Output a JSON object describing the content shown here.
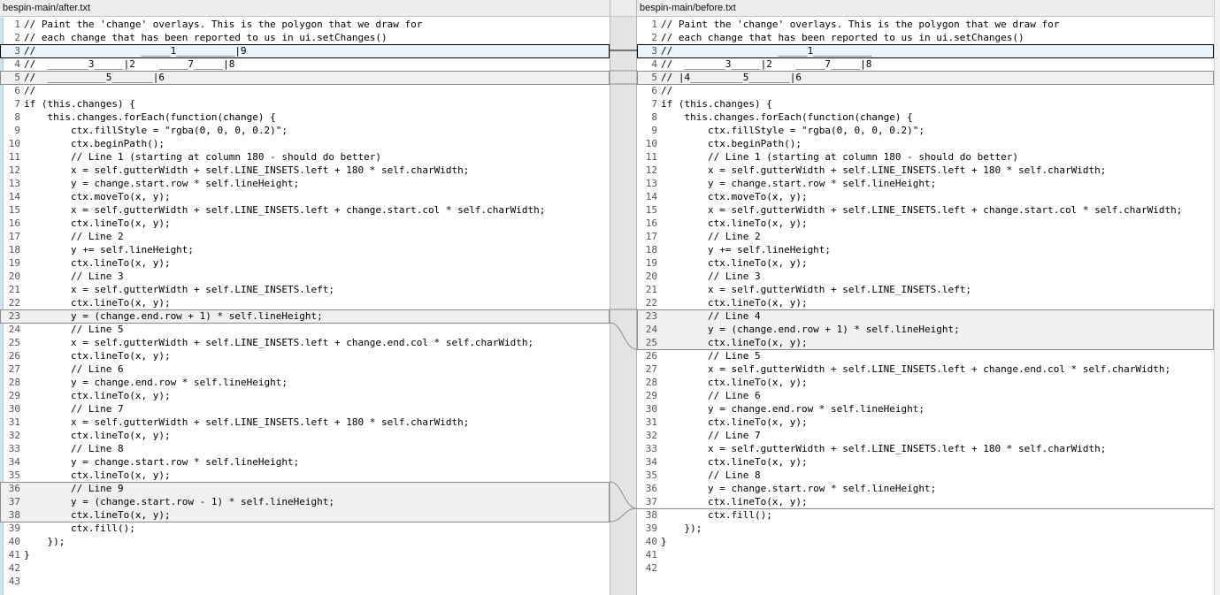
{
  "left_pane": {
    "title": "bespin-main/after.txt",
    "lines": [
      "// Paint the 'change' overlays. This is the polygon that we draw for",
      "// each change that has been reported to us in ui.setChanges()",
      "//                  _____1__________|9",
      "//  _______3_____|2    _____7_____|8",
      "//  __________5_______|6",
      "//",
      "if (this.changes) {",
      "    this.changes.forEach(function(change) {",
      "        ctx.fillStyle = \"rgba(0, 0, 0, 0.2)\";",
      "        ctx.beginPath();",
      "        // Line 1 (starting at column 180 - should do better)",
      "        x = self.gutterWidth + self.LINE_INSETS.left + 180 * self.charWidth;",
      "        y = change.start.row * self.lineHeight;",
      "        ctx.moveTo(x, y);",
      "        x = self.gutterWidth + self.LINE_INSETS.left + change.start.col * self.charWidth;",
      "        ctx.lineTo(x, y);",
      "        // Line 2",
      "        y += self.lineHeight;",
      "        ctx.lineTo(x, y);",
      "        // Line 3",
      "        x = self.gutterWidth + self.LINE_INSETS.left;",
      "        ctx.lineTo(x, y);",
      "        y = (change.end.row + 1) * self.lineHeight;",
      "        // Line 5",
      "        x = self.gutterWidth + self.LINE_INSETS.left + change.end.col * self.charWidth;",
      "        ctx.lineTo(x, y);",
      "        // Line 6",
      "        y = change.end.row * self.lineHeight;",
      "        ctx.lineTo(x, y);",
      "        // Line 7",
      "        x = self.gutterWidth + self.LINE_INSETS.left + 180 * self.charWidth;",
      "        ctx.lineTo(x, y);",
      "        // Line 8",
      "        y = change.start.row * self.lineHeight;",
      "        ctx.lineTo(x, y);",
      "        // Line 9",
      "        y = (change.start.row - 1) * self.lineHeight;",
      "        ctx.lineTo(x, y);",
      "        ctx.fill();",
      "    });",
      "}",
      "",
      ""
    ]
  },
  "right_pane": {
    "title": "bespin-main/before.txt",
    "lines": [
      "// Paint the 'change' overlays. This is the polygon that we draw for",
      "// each change that has been reported to us in ui.setChanges()",
      "//                  _____1__________",
      "//  _______3_____|2    _____7_____|8",
      "// |4_________5_______|6",
      "//",
      "if (this.changes) {",
      "    this.changes.forEach(function(change) {",
      "        ctx.fillStyle = \"rgba(0, 0, 0, 0.2)\";",
      "        ctx.beginPath();",
      "        // Line 1 (starting at column 180 - should do better)",
      "        x = self.gutterWidth + self.LINE_INSETS.left + 180 * self.charWidth;",
      "        y = change.start.row * self.lineHeight;",
      "        ctx.moveTo(x, y);",
      "        x = self.gutterWidth + self.LINE_INSETS.left + change.start.col * self.charWidth;",
      "        ctx.lineTo(x, y);",
      "        // Line 2",
      "        y += self.lineHeight;",
      "        ctx.lineTo(x, y);",
      "        // Line 3",
      "        x = self.gutterWidth + self.LINE_INSETS.left;",
      "        ctx.lineTo(x, y);",
      "        // Line 4",
      "        y = (change.end.row + 1) * self.lineHeight;",
      "        ctx.lineTo(x, y);",
      "        // Line 5",
      "        x = self.gutterWidth + self.LINE_INSETS.left + change.end.col * self.charWidth;",
      "        ctx.lineTo(x, y);",
      "        // Line 6",
      "        y = change.end.row * self.lineHeight;",
      "        ctx.lineTo(x, y);",
      "        // Line 7",
      "        x = self.gutterWidth + self.LINE_INSETS.left + 180 * self.charWidth;",
      "        ctx.lineTo(x, y);",
      "        // Line 8",
      "        y = change.start.row * self.lineHeight;",
      "        ctx.lineTo(x, y);",
      "        ctx.fill();",
      "    });",
      "}",
      "",
      ""
    ]
  }
}
